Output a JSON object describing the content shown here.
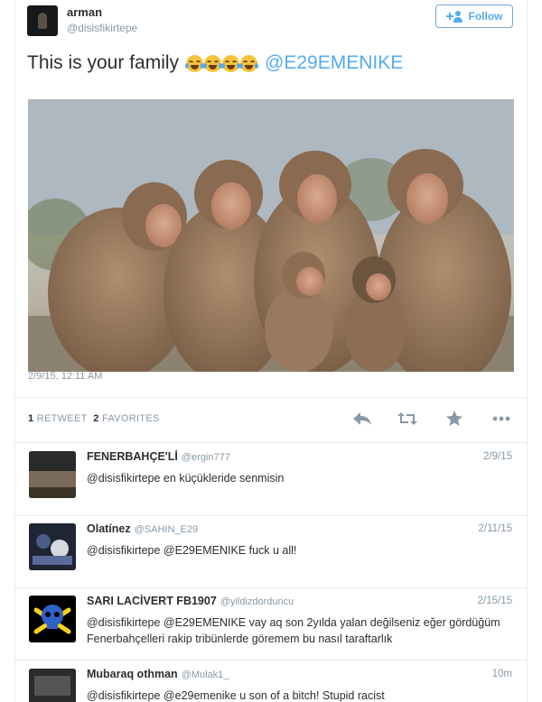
{
  "tweet": {
    "author_name": "arman",
    "author_handle": "@disisfikirtepe",
    "follow_label": "Follow",
    "text": "This is your family",
    "emoji": [
      "face-with-tears-of-joy",
      "face-with-tears-of-joy",
      "face-with-tears-of-joy",
      "face-with-tears-of-joy"
    ],
    "mention": "@E29EMENIKE",
    "timestamp": "2/9/15, 12:11 AM",
    "retweet_count": "1",
    "retweet_label": "RETWEET",
    "favorite_count": "2",
    "favorite_label": "FAVORITES",
    "actions": [
      "reply-icon",
      "retweet-icon",
      "favorite-star-icon",
      "more-dots-icon"
    ]
  },
  "replies": [
    {
      "name": "FENERBAHÇE'Lİ",
      "handle": "@ergin777",
      "time": "2/9/15",
      "text": "@disisfikirtepe en küçükleride senmisin"
    },
    {
      "name": "Olatínez",
      "handle": "@SAHIN_E29",
      "time": "2/11/15",
      "text": "@disisfikirtepe @E29EMENIKE fuck u all!"
    },
    {
      "name": "SARI LACİVERT FB1907",
      "handle": "@yildizdorduncu",
      "time": "2/15/15",
      "text": "@disisfikirtepe @E29EMENIKE vay aq  son 2yılda yalan değilseniz eğer gördüğüm Fenerbahçelleri rakip tribünlerde göremem bu nasıl taraftarlık"
    },
    {
      "name": "Mubaraq othman",
      "handle": "@Mulak1_",
      "time": "10m",
      "text": "@disisfikirtepe @e29emenike u son of a bitch! Stupid racist"
    }
  ],
  "colors": {
    "link": "#55acee",
    "muted": "#8899a6",
    "text": "#292f33"
  }
}
